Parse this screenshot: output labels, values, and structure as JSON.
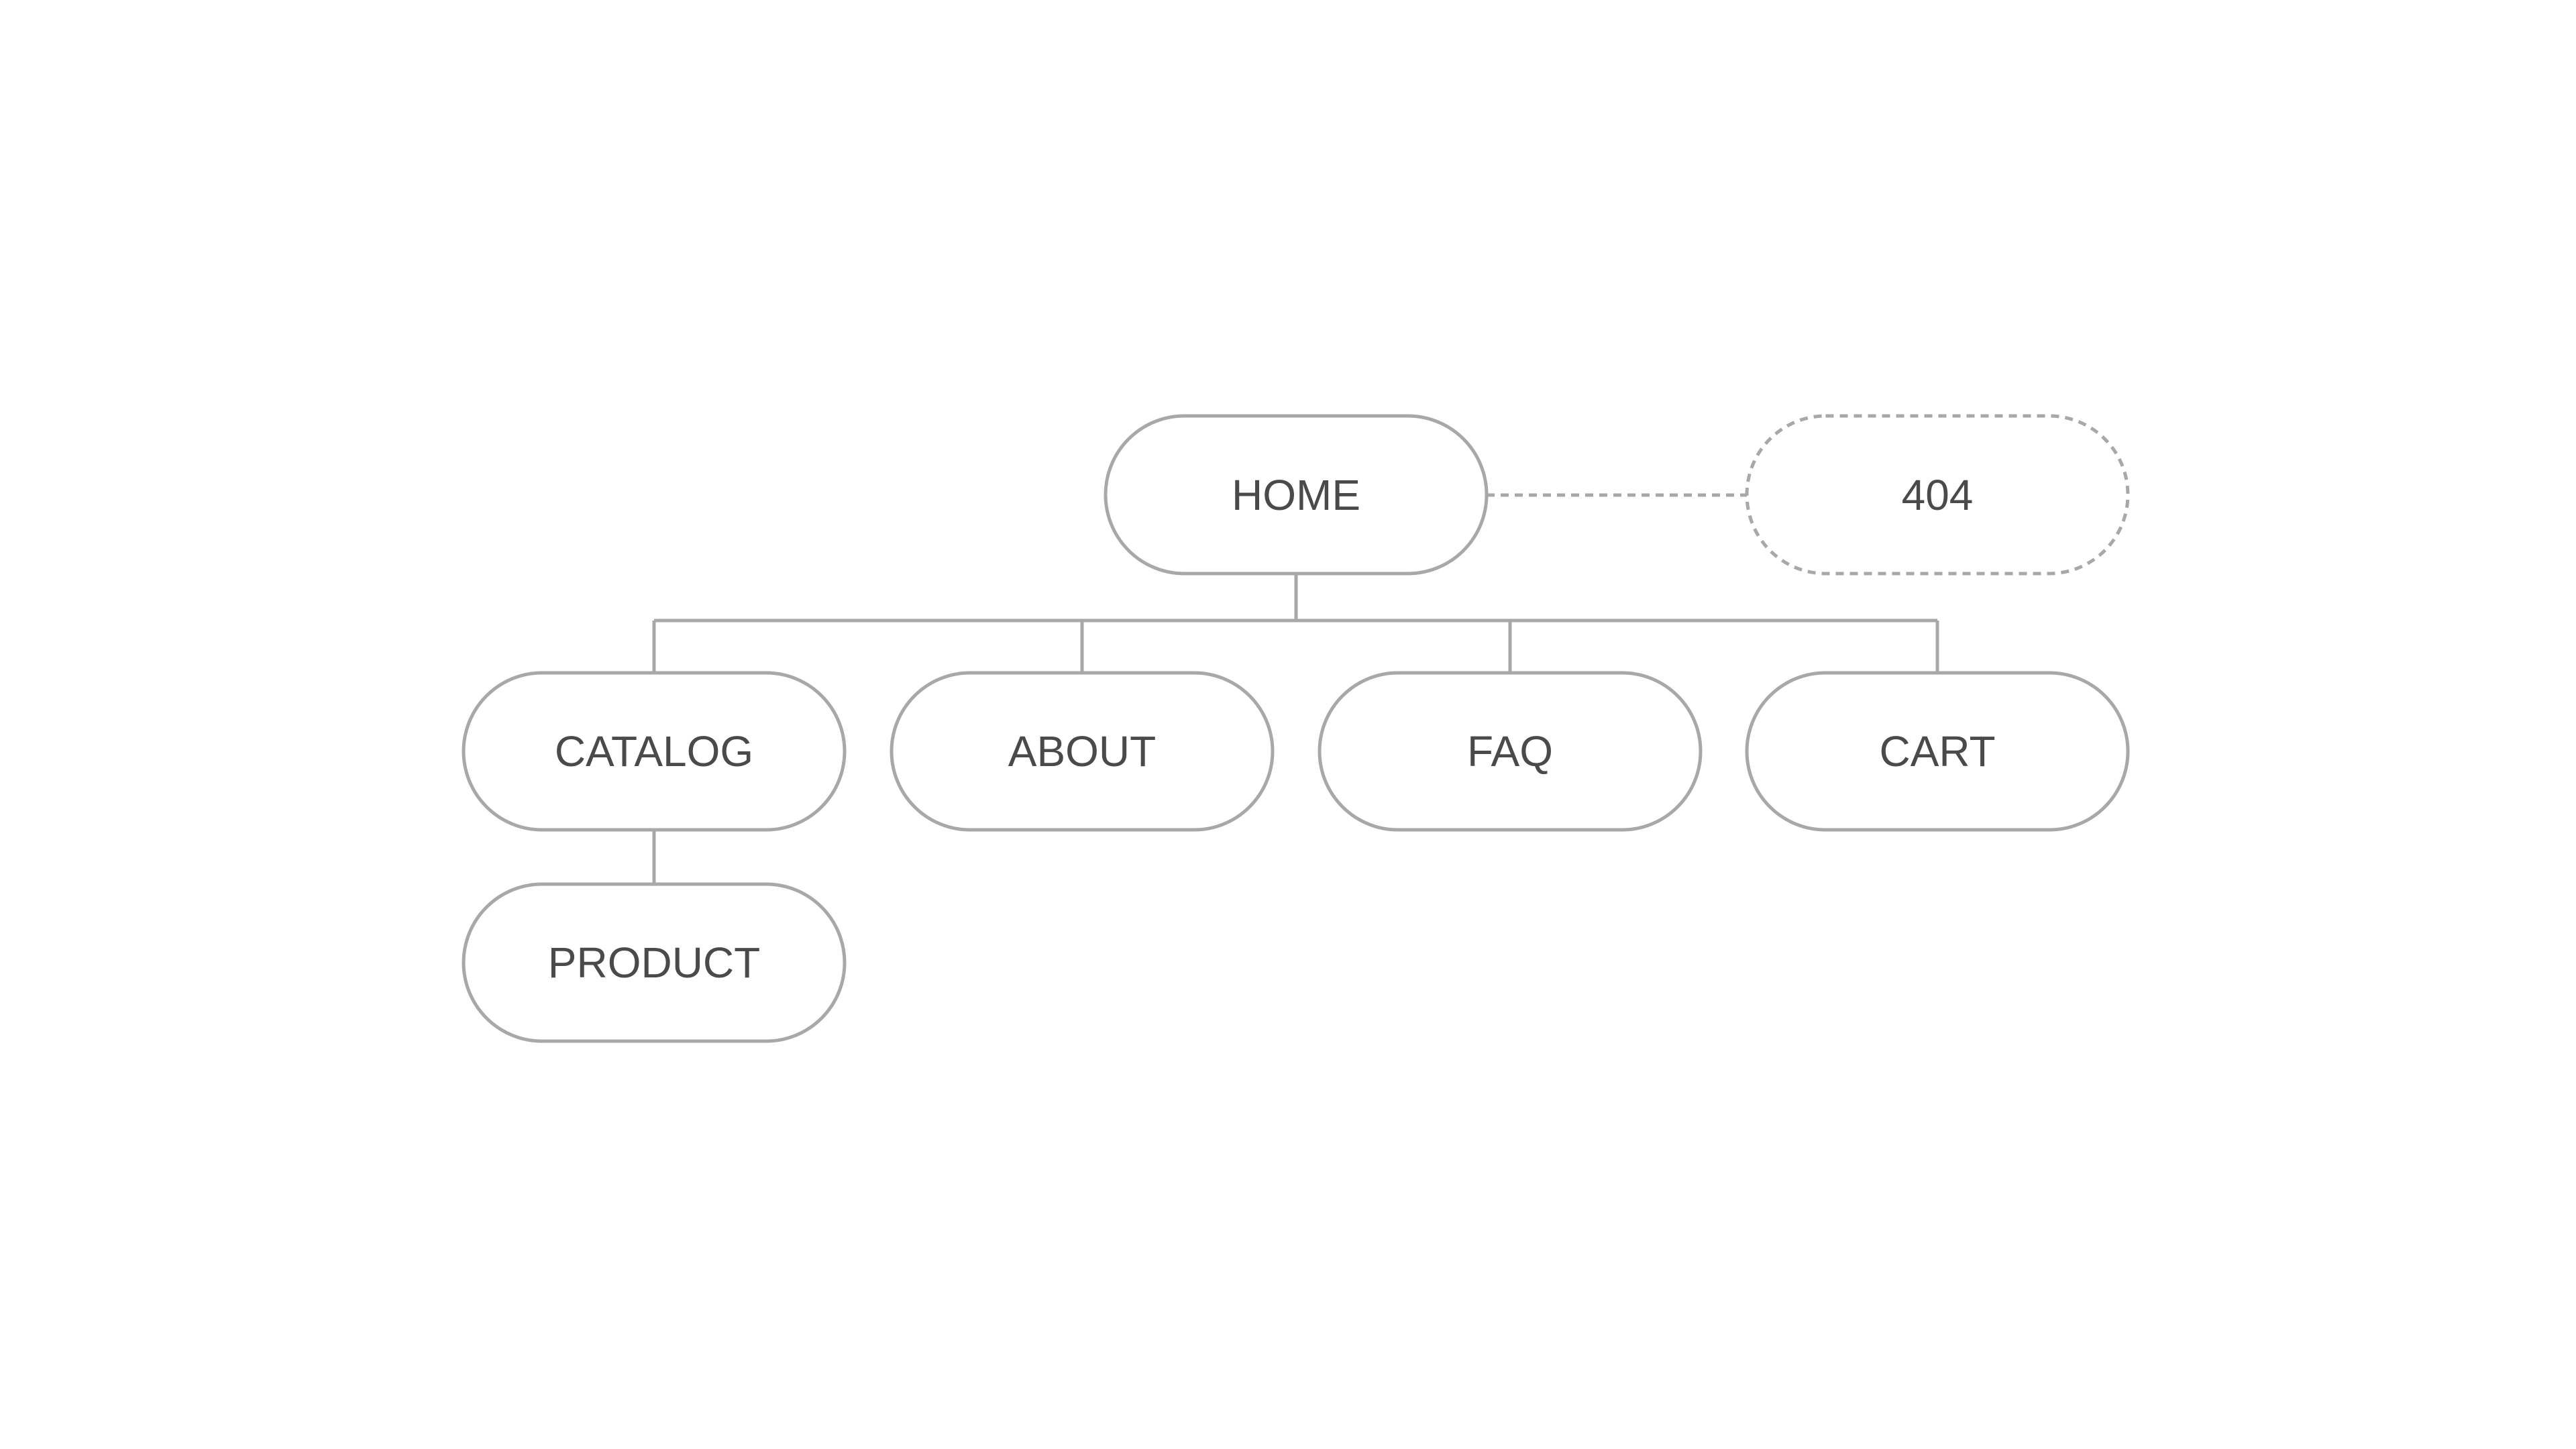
{
  "diagram": {
    "colors": {
      "stroke": "#a8a8a8",
      "text": "#4a4a4a",
      "background": "#ffffff"
    },
    "nodes": {
      "home": {
        "label": "HOME"
      },
      "not_found": {
        "label": "404",
        "style": "dashed"
      },
      "catalog": {
        "label": "CATALOG"
      },
      "about": {
        "label": "ABOUT"
      },
      "faq": {
        "label": "FAQ"
      },
      "cart": {
        "label": "CART"
      },
      "product": {
        "label": "PRODUCT"
      }
    },
    "edges": [
      {
        "from": "home",
        "to": "not_found",
        "style": "dashed"
      },
      {
        "from": "home",
        "to": "catalog",
        "style": "solid"
      },
      {
        "from": "home",
        "to": "about",
        "style": "solid"
      },
      {
        "from": "home",
        "to": "faq",
        "style": "solid"
      },
      {
        "from": "home",
        "to": "cart",
        "style": "solid"
      },
      {
        "from": "catalog",
        "to": "product",
        "style": "solid"
      }
    ]
  }
}
